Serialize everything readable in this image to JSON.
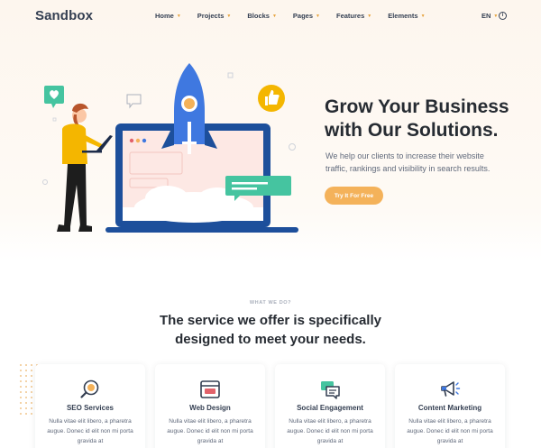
{
  "navbar": {
    "brand": "Sandbox",
    "items": [
      {
        "label": "Home"
      },
      {
        "label": "Projects"
      },
      {
        "label": "Blocks"
      },
      {
        "label": "Pages"
      },
      {
        "label": "Features"
      },
      {
        "label": "Elements"
      }
    ],
    "language": "EN",
    "info_icon": "info-icon"
  },
  "hero": {
    "title_line1": "Grow Your Business",
    "title_line2": "with Our Solutions.",
    "lead": "We help our clients to increase their website traffic, rankings and visibility in search results.",
    "cta": "Try It For Free",
    "accent": "#f4b25a"
  },
  "services": {
    "eyebrow": "WHAT WE DO?",
    "title_line1": "The service we offer is specifically",
    "title_line2": "designed to meet your needs.",
    "cards": [
      {
        "icon": "seo-magnifier-icon",
        "title": "SEO Services",
        "text": "Nulla vitae elit libero, a pharetra augue. Donec id elit non mi porta gravida at"
      },
      {
        "icon": "web-design-browser-icon",
        "title": "Web Design",
        "text": "Nulla vitae elit libero, a pharetra augue. Donec id elit non mi porta gravida at"
      },
      {
        "icon": "social-chat-icon",
        "title": "Social Engagement",
        "text": "Nulla vitae elit libero, a pharetra augue. Donec id elit non mi porta gravida at"
      },
      {
        "icon": "megaphone-icon",
        "title": "Content Marketing",
        "text": "Nulla vitae elit libero, a pharetra augue. Donec id elit non mi porta gravida at"
      }
    ]
  },
  "colors": {
    "primary_blue": "#3f78e0",
    "navy": "#1d4f9b",
    "yellow": "#f4b25a",
    "green": "#45c4a0",
    "text_dark": "#262b32"
  }
}
